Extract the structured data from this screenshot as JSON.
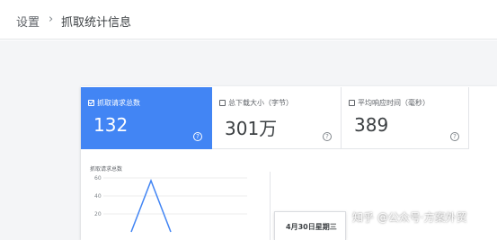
{
  "breadcrumb": {
    "root": "设置",
    "separator": "›",
    "current": "抓取统计信息"
  },
  "cards": [
    {
      "label": "抓取请求总数",
      "value": "132",
      "checked": true
    },
    {
      "label": "总下载大小（字节）",
      "value": "301万",
      "checked": false
    },
    {
      "label": "平均响应时间（毫秒）",
      "value": "389",
      "checked": false
    }
  ],
  "help_icon": "?",
  "chart_data": {
    "type": "line",
    "title": "抓取请求总数",
    "yticks": [
      60,
      40,
      20
    ],
    "ylim": [
      0,
      60
    ],
    "series": [
      {
        "values": [
          0,
          57,
          0
        ]
      }
    ]
  },
  "tooltip": {
    "date": "4月30日星期三"
  },
  "watermark": "知乎 @公众号·方案外贸",
  "colors": {
    "accent": "#4285f4",
    "line": "#4285f4"
  }
}
